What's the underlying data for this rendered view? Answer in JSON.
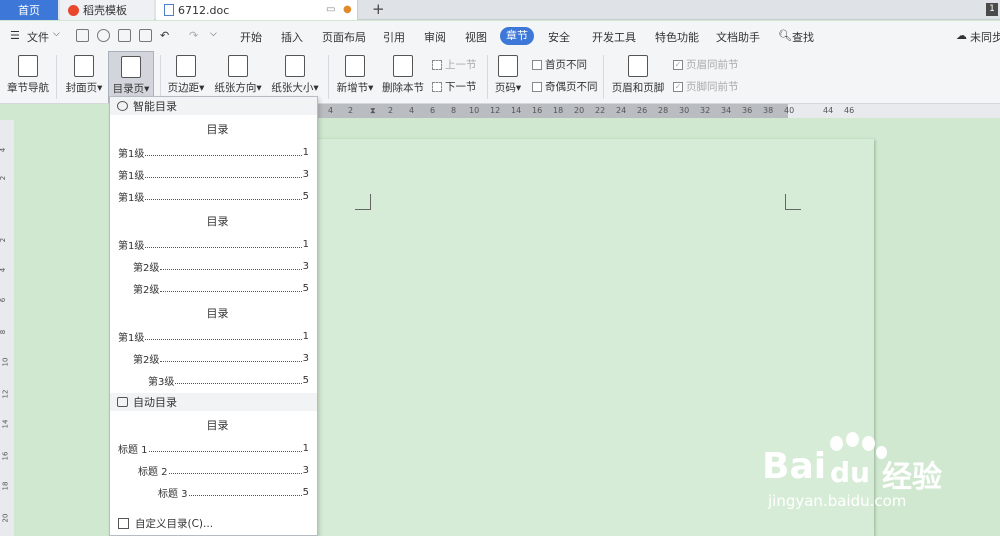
{
  "tabs": {
    "home": "首页",
    "template": "稻壳模板",
    "doc": "6712.doc",
    "badge": "1"
  },
  "menu": {
    "file": "文件",
    "items": [
      "开始",
      "插入",
      "页面布局",
      "引用",
      "审阅",
      "视图",
      "章节",
      "安全",
      "开发工具",
      "特色功能",
      "文档助手"
    ],
    "active": "章节",
    "search": "查找",
    "sync": "未同步"
  },
  "ribbon": {
    "chapter_nav": "章节导航",
    "cover": "封面页",
    "toc_page": "目录页",
    "margin": "页边距",
    "orientation": "纸张方向",
    "size": "纸张大小",
    "new_section": "新增节",
    "delete_section": "删除本节",
    "prev_section": "上一节",
    "next_section": "下一节",
    "page_number": "页码",
    "first_page_diff": "首页不同",
    "odd_even_diff": "奇偶页不同",
    "header_footer": "页眉和页脚",
    "header_same_prev": "页眉同前节",
    "footer_same_prev": "页脚同前节"
  },
  "ruler": {
    "dark_ticks": [
      "4",
      "2",
      "",
      "2",
      "4",
      "6",
      "8",
      "10",
      "12",
      "14",
      "16",
      "18",
      "20",
      "22",
      "24",
      "26",
      "28",
      "30",
      "32",
      "34",
      "36",
      "38",
      "40"
    ],
    "light_ticks": [
      "44",
      "46"
    ],
    "vertical": [
      "4",
      "2",
      "2",
      "4",
      "6",
      "8",
      "10",
      "12",
      "14",
      "16",
      "18",
      "20"
    ]
  },
  "dropdown": {
    "smart_toc": "智能目录",
    "blocks": [
      {
        "title": "目录",
        "rows": [
          {
            "text": "第1级",
            "page": "1"
          },
          {
            "text": "第1级",
            "page": "3"
          },
          {
            "text": "第1级",
            "page": "5"
          }
        ]
      },
      {
        "title": "目录",
        "rows": [
          {
            "text": "第1级",
            "page": "1"
          },
          {
            "text": "第2级",
            "page": "3"
          },
          {
            "text": "第2级",
            "page": "5"
          }
        ]
      },
      {
        "title": "目录",
        "rows": [
          {
            "text": "第1级",
            "page": "1"
          },
          {
            "text": "第2级",
            "page": "3"
          },
          {
            "text": "第3级",
            "page": "5"
          }
        ]
      }
    ],
    "auto_toc": "自动目录",
    "auto_block": {
      "title": "目录",
      "rows": [
        {
          "text": "标题 1",
          "page": "1"
        },
        {
          "text": "标题 2",
          "page": "3"
        },
        {
          "text": "标题 3",
          "page": "5"
        }
      ]
    },
    "custom": "自定义目录(C)..."
  },
  "watermark": {
    "brand": "Bai",
    "brand2": "经验",
    "url": "jingyan.baidu.com"
  }
}
